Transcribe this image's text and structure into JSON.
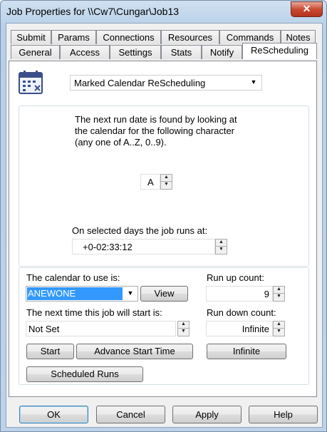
{
  "window": {
    "title": "Job Properties for \\\\Cw7\\Cungar\\Job13",
    "close_glyph": "✕"
  },
  "tabs_row1": [
    "Submit",
    "Params",
    "Connections",
    "Resources",
    "Commands",
    "Notes"
  ],
  "tabs_row2": [
    "General",
    "Access",
    "Settings",
    "Stats",
    "Notify",
    "ReScheduling"
  ],
  "active_tab": "ReScheduling",
  "rescheduling": {
    "mode_value": "Marked Calendar ReScheduling",
    "description_lines": [
      "The next run date is found by looking at",
      "the calendar for the following character",
      "(any one of A..Z, 0..9)."
    ],
    "character_value": "A",
    "runs_at_label": "On selected days the job runs at:",
    "runs_at_value": "+0-02:33:12",
    "calendar_label": "The calendar to use is:",
    "calendar_value": "ANEWONE",
    "view_button": "View",
    "next_time_label": "The next time this job will start is:",
    "next_time_value": "Not Set",
    "start_button": "Start",
    "advance_button": "Advance Start Time",
    "scheduled_runs_button": "Scheduled Runs",
    "run_up_label": "Run up count:",
    "run_up_value": "9",
    "run_down_label": "Run down count:",
    "run_down_value": "Infinite",
    "infinite_button": "Infinite"
  },
  "footer": {
    "ok": "OK",
    "cancel": "Cancel",
    "apply": "Apply",
    "help": "Help"
  }
}
